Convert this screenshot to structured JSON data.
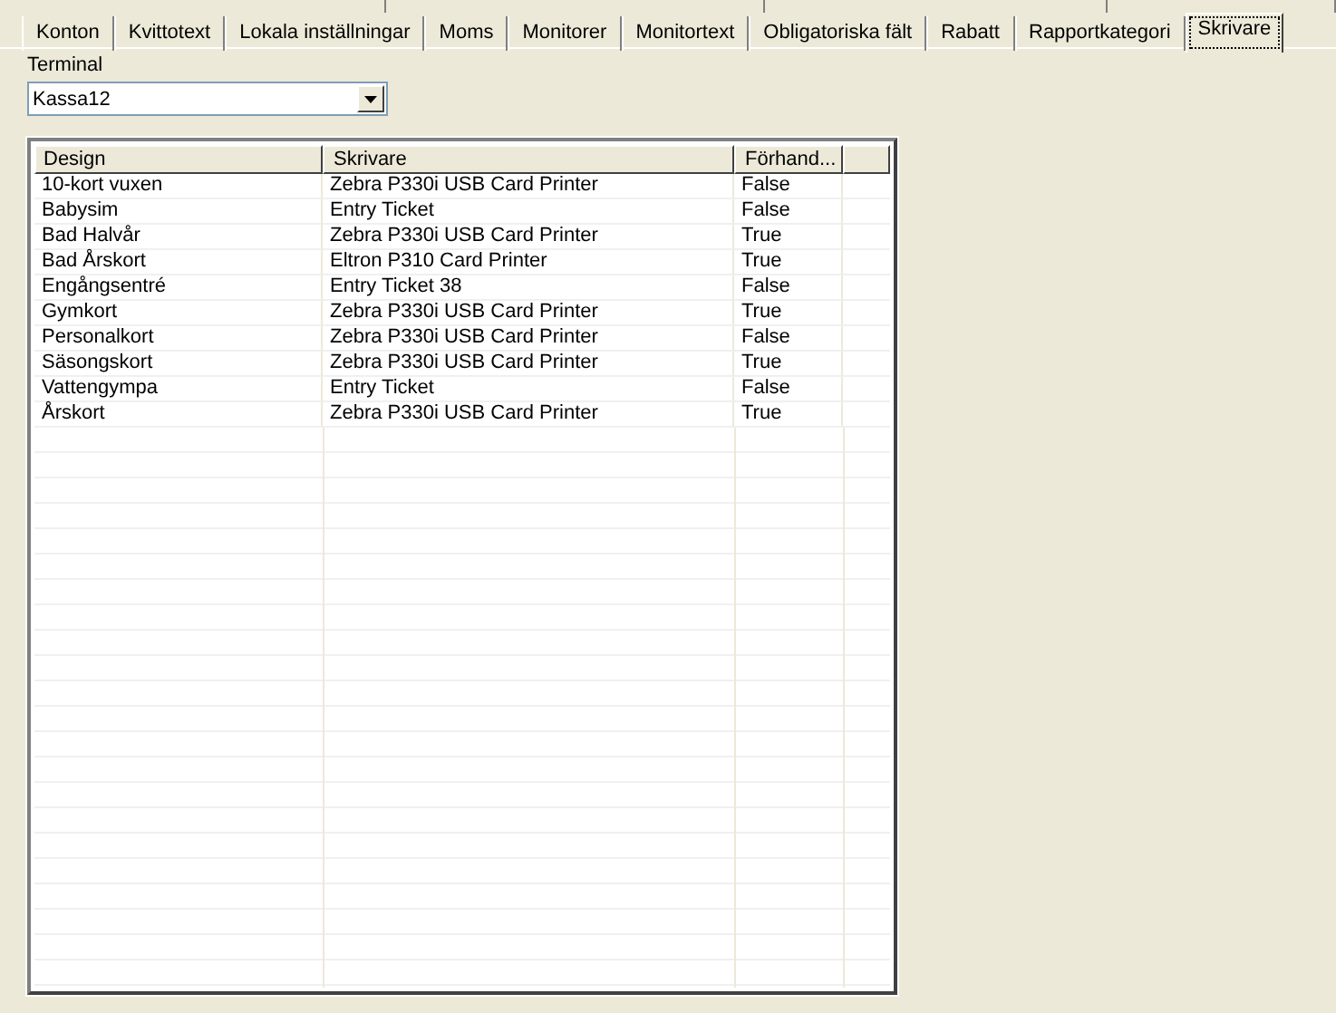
{
  "tabs": [
    {
      "label": "Konton",
      "selected": false
    },
    {
      "label": "Kvittotext",
      "selected": false
    },
    {
      "label": "Lokala inställningar",
      "selected": false
    },
    {
      "label": "Moms",
      "selected": false
    },
    {
      "label": "Monitorer",
      "selected": false
    },
    {
      "label": "Monitortext",
      "selected": false
    },
    {
      "label": "Obligatoriska fält",
      "selected": false
    },
    {
      "label": "Rabatt",
      "selected": false
    },
    {
      "label": "Rapportkategori",
      "selected": false
    },
    {
      "label": "Skrivare",
      "selected": true
    }
  ],
  "terminal": {
    "label": "Terminal",
    "value": "Kassa12"
  },
  "table": {
    "columns": [
      "Design",
      "Skrivare",
      "Förhand..."
    ],
    "rows": [
      [
        "10-kort vuxen",
        "Zebra P330i USB Card Printer",
        "False"
      ],
      [
        "Babysim",
        "Entry Ticket",
        "False"
      ],
      [
        "Bad Halvår",
        "Zebra P330i USB Card Printer",
        "True"
      ],
      [
        "Bad Årskort",
        "Eltron P310 Card Printer",
        "True"
      ],
      [
        "Engångsentré",
        "Entry Ticket 38",
        "False"
      ],
      [
        "Gymkort",
        "Zebra P330i USB Card Printer",
        "True"
      ],
      [
        "Personalkort",
        "Zebra P330i USB Card Printer",
        "False"
      ],
      [
        "Säsongskort",
        "Zebra P330i USB Card Printer",
        "True"
      ],
      [
        "Vattengympa",
        "Entry Ticket",
        "False"
      ],
      [
        "Årskort",
        "Zebra P330i USB Card Printer",
        "True"
      ]
    ]
  }
}
